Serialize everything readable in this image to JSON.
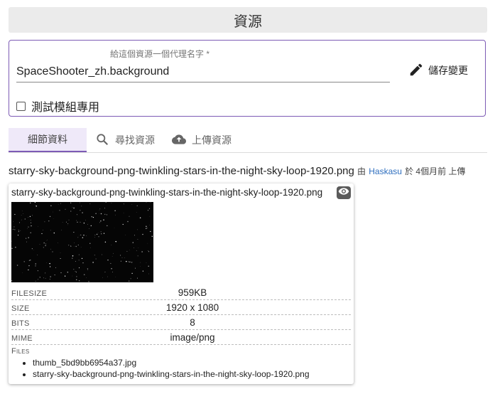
{
  "header": {
    "title": "資源"
  },
  "form": {
    "name_label": "給這個資源一個代理名字 *",
    "name_value": "SpaceShooter_zh.background",
    "save_label": "儲存變更",
    "test_mod_label": "測試模組專用"
  },
  "tabs": [
    {
      "label": "細節資料",
      "active": true,
      "icon": "none"
    },
    {
      "label": "尋找資源",
      "active": false,
      "icon": "search-icon"
    },
    {
      "label": "上傳資源",
      "active": false,
      "icon": "cloud-upload-icon"
    }
  ],
  "file": {
    "filename": "starry-sky-background-png-twinkling-stars-in-the-night-sky-loop-1920.png",
    "by_text": "由",
    "uploader": "Haskasu",
    "time_text": "於 4個月前 上傳"
  },
  "card": {
    "title": "starry-sky-background-png-twinkling-stars-in-the-night-sky-loop-1920.png",
    "props": [
      {
        "key": "fileSize",
        "value": "959KB"
      },
      {
        "key": "size",
        "value": "1920 x 1080"
      },
      {
        "key": "bits",
        "value": "8"
      },
      {
        "key": "mime",
        "value": "image/png"
      }
    ],
    "files_label": "Files",
    "files": [
      "thumb_5bd9bb6954a37.jpg",
      "starry-sky-background-png-twinkling-stars-in-the-night-sky-loop-1920.png"
    ]
  },
  "colors": {
    "accent": "#7d5bb5",
    "link": "#2f6fbf",
    "header_bg": "#ebebeb"
  }
}
